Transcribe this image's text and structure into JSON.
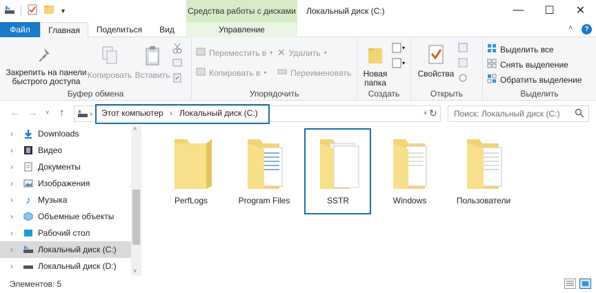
{
  "titlebar": {
    "context_tab_header": "Средства работы с дисками",
    "window_title": "Локальный диск (C:)",
    "minimize_glyph": "—",
    "maximize_glyph": "☐",
    "close_glyph": "✕"
  },
  "tabs": {
    "file": "Файл",
    "home": "Главная",
    "share": "Поделиться",
    "view": "Вид",
    "manage": "Управление",
    "collapse_glyph": "˄",
    "help_glyph": "?"
  },
  "ribbon": {
    "clipboard": {
      "label": "Буфер обмена",
      "pin_line1": "Закрепить на панели",
      "pin_line2": "быстрого доступа",
      "copy": "Копировать",
      "paste": "Вставить"
    },
    "organize": {
      "label": "Упорядочить",
      "move_to": "Переместить в",
      "copy_to": "Копировать в",
      "delete": "Удалить",
      "rename": "Переименовать"
    },
    "new": {
      "label": "Создать",
      "new_folder_line1": "Новая",
      "new_folder_line2": "папка"
    },
    "open": {
      "label": "Открыть",
      "properties": "Свойства"
    },
    "select": {
      "label": "Выделить",
      "select_all": "Выделить все",
      "select_none": "Снять выделение",
      "invert": "Обратить выделение"
    }
  },
  "address": {
    "crumbs": [
      "Этот компьютер",
      "Локальный диск (C:)"
    ],
    "separator": "›",
    "search_placeholder": "Поиск: Локальный диск (C:)"
  },
  "sidebar": {
    "items": [
      {
        "label": "Downloads",
        "icon": "download-icon"
      },
      {
        "label": "Видео",
        "icon": "video-icon"
      },
      {
        "label": "Документы",
        "icon": "documents-icon"
      },
      {
        "label": "Изображения",
        "icon": "pictures-icon"
      },
      {
        "label": "Музыка",
        "icon": "music-icon"
      },
      {
        "label": "Объемные объекты",
        "icon": "3d-objects-icon"
      },
      {
        "label": "Рабочий стол",
        "icon": "desktop-icon"
      },
      {
        "label": "Локальный диск (C:)",
        "icon": "drive-c-icon",
        "selected": true
      },
      {
        "label": "Локальный диск (D:)",
        "icon": "drive-d-icon"
      }
    ]
  },
  "content": {
    "folders": [
      {
        "name": "PerfLogs",
        "has_files": false
      },
      {
        "name": "Program Files",
        "has_files": true
      },
      {
        "name": "SSTR",
        "has_files": true,
        "selected": true
      },
      {
        "name": "Windows",
        "has_files": true
      },
      {
        "name": "Пользователи",
        "has_files": true
      }
    ]
  },
  "status": {
    "items_count": "Элементов: 5"
  },
  "colors": {
    "accent": "#1979ca",
    "context_tab": "#d6ecc7",
    "highlight_box": "#1a6fa8",
    "folder": "#f3d373"
  }
}
